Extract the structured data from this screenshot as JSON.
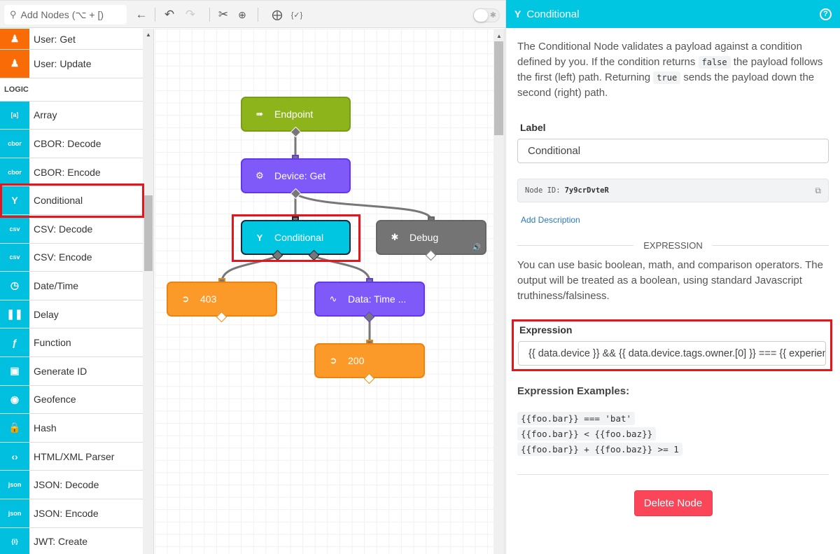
{
  "toolbar": {
    "search_placeholder": "Add Nodes (⌥ + [)",
    "icons": [
      "back-arrow-icon",
      "undo-icon",
      "redo-icon",
      "cut-icon",
      "zoom-in-icon",
      "add-comment-icon",
      "validate-icon",
      "debug-toggle"
    ]
  },
  "sidebar": {
    "top_items": [
      {
        "label": "User: Get",
        "icon": "user-search-icon"
      },
      {
        "label": "User: Update",
        "icon": "user-edit-icon"
      }
    ],
    "section": "LOGIC",
    "items": [
      {
        "label": "Array",
        "icon": "[a]"
      },
      {
        "label": "CBOR: Decode",
        "icon": "cbor"
      },
      {
        "label": "CBOR: Encode",
        "icon": "cbor"
      },
      {
        "label": "Conditional",
        "icon": "Y"
      },
      {
        "label": "CSV: Decode",
        "icon": "csv"
      },
      {
        "label": "CSV: Encode",
        "icon": "csv"
      },
      {
        "label": "Date/Time",
        "icon": "◷"
      },
      {
        "label": "Delay",
        "icon": "❚❚"
      },
      {
        "label": "Function",
        "icon": "ƒ"
      },
      {
        "label": "Generate ID",
        "icon": "▣"
      },
      {
        "label": "Geofence",
        "icon": "◉"
      },
      {
        "label": "Hash",
        "icon": "🔒"
      },
      {
        "label": "HTML/XML Parser",
        "icon": "‹›"
      },
      {
        "label": "JSON: Decode",
        "icon": "json"
      },
      {
        "label": "JSON: Encode",
        "icon": "json"
      },
      {
        "label": "JWT: Create",
        "icon": "{i}"
      }
    ]
  },
  "canvas": {
    "nodes": [
      {
        "label": "Endpoint",
        "type": "trigger",
        "color": "#8db41b"
      },
      {
        "label": "Device: Get",
        "type": "data",
        "color": "#7f5af8"
      },
      {
        "label": "Conditional",
        "type": "logic",
        "color": "#00c6e2",
        "selected": true
      },
      {
        "label": "Debug",
        "type": "debug",
        "color": "#747474"
      },
      {
        "label": "403",
        "type": "output",
        "color": "#fb9a28"
      },
      {
        "label": "Data: Time ...",
        "type": "data",
        "color": "#7f5af8"
      },
      {
        "label": "200",
        "type": "output",
        "color": "#fb9a28"
      }
    ]
  },
  "panel": {
    "title": "Conditional",
    "help": "?",
    "desc_1": "The Conditional Node validates a payload against a condition defined by you. If the condition returns ",
    "desc_code_1": "false",
    "desc_2": " the payload follows the first (left) path. Returning ",
    "desc_code_2": "true",
    "desc_3": " sends the payload down the second (right) path.",
    "label_title": "Label",
    "label_value": "Conditional",
    "node_id_label": "Node ID:",
    "node_id_value": "7y9crDvteR",
    "add_description": "Add Description",
    "section_title": "EXPRESSION",
    "expr_help": "You can use basic boolean, math, and comparison operators. The output will be treated as a boolean, using standard Javascript truthiness/falsiness.",
    "expression_label": "Expression",
    "expression_value": "{{ data.device }} && {{ data.device.tags.owner.[0] }} === {{ experience.user.id }}",
    "examples_title": "Expression Examples:",
    "examples": [
      "{{foo.bar}} === 'bat'",
      "{{foo.bar}} < {{foo.baz}}",
      "{{foo.bar}} + {{foo.baz}} >= 1"
    ],
    "delete_label": "Delete Node",
    "accent": "#00c6e2",
    "danger": "#fb4659"
  }
}
